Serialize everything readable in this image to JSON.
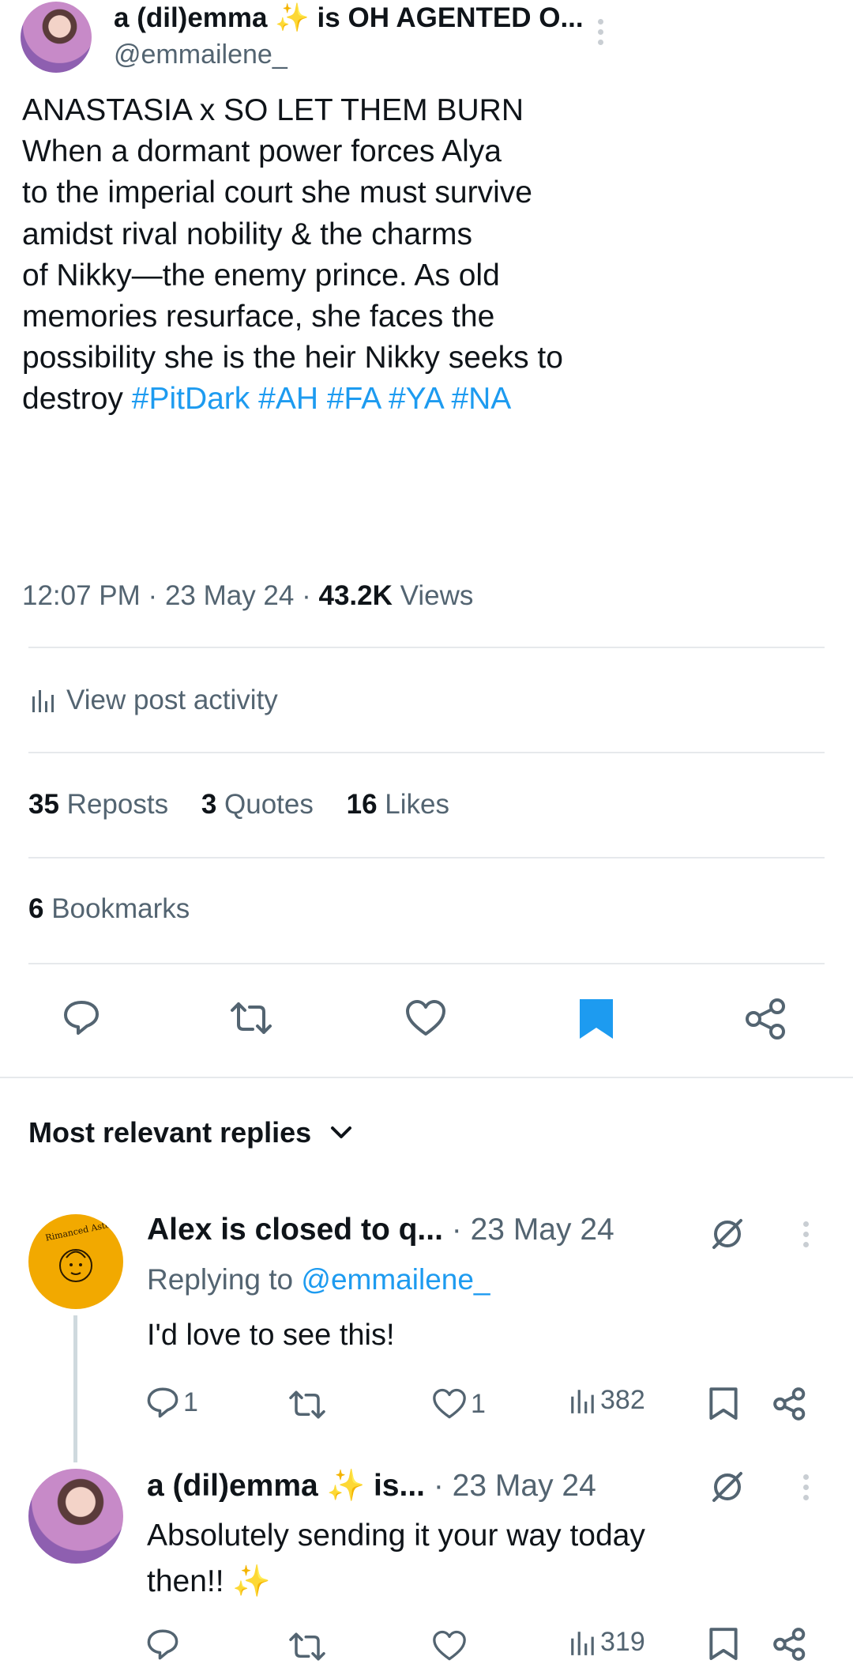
{
  "post": {
    "author_name": "a (dil)emma",
    "author_suffix": " is OH AGENTED O...",
    "handle": "@emmailene_",
    "text_lines": [
      "ANASTASIA x SO LET THEM BURN",
      "When a dormant power forces Alya",
      "to the imperial court she must survive",
      "amidst rival nobility & the charms",
      "of Nikky—the enemy prince. As old",
      "memories resurface, she faces the",
      "possibility she is the heir Nikky seeks to"
    ],
    "last_line_prefix": "destroy",
    "hashtags": [
      "#PitDark",
      "#AH",
      "#FA",
      "#YA",
      "#NA"
    ],
    "time": "12:07 PM",
    "date": "23 May 24",
    "views_count": "43.2K",
    "views_label": "Views",
    "activity_label": "View post activity",
    "reposts_count": "35",
    "reposts_label": "Reposts",
    "quotes_count": "3",
    "quotes_label": "Quotes",
    "likes_count": "16",
    "likes_label": "Likes",
    "bookmarks_count": "6",
    "bookmarks_label": "Bookmarks"
  },
  "replies_header": {
    "label": "Most relevant replies"
  },
  "replies": [
    {
      "author": "Alex is closed to q...",
      "date": "· 23 May 24",
      "replying_prefix": "Replying to",
      "replying_handle": "@emmailene_",
      "text": "I'd love to see this!",
      "reply_count": "1",
      "like_count": "1",
      "view_count": "382",
      "avatar_text": "Rimanced Asterion"
    },
    {
      "author": "a (dil)emma",
      "author_suffix": " is...",
      "date": "· 23 May 24",
      "text_line1": "Absolutely sending it your way today",
      "text_line2": "then!!",
      "view_count": "319"
    }
  ],
  "colors": {
    "accent": "#1d9bf0",
    "text": "#0f1419",
    "muted": "#536471",
    "sparkle": "#f4c430"
  },
  "icons": [
    "kebab-icon",
    "sparkle-icon",
    "stats-icon",
    "reply-icon",
    "repost-icon",
    "like-icon",
    "bookmark-icon",
    "share-icon",
    "chevron-down-icon",
    "grok-icon"
  ]
}
